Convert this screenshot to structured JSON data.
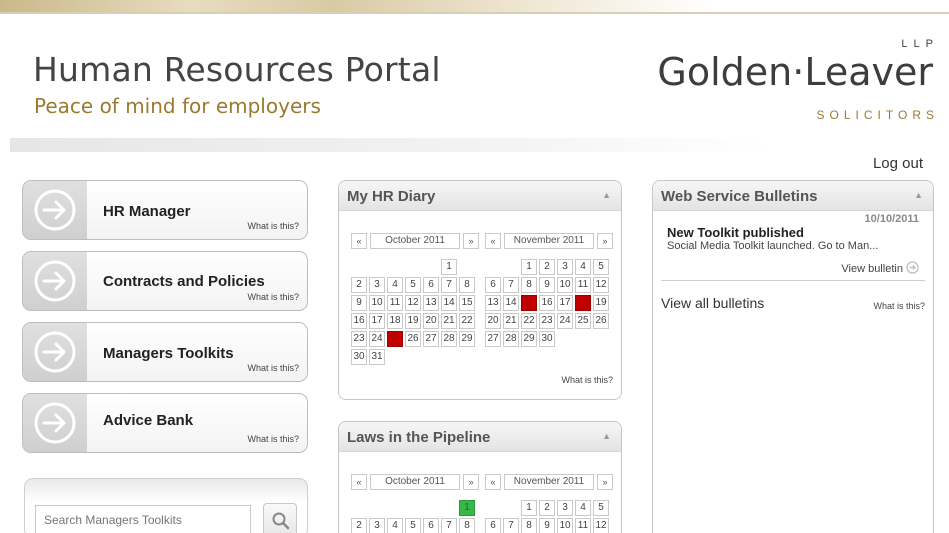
{
  "header": {
    "portal_title": "Human Resources Portal",
    "tagline": "Peace of mind for employers",
    "logo": {
      "llp": "LLP",
      "name": "Golden·Leaver",
      "sub": "SOLICITORS"
    },
    "logout_label": "Log out"
  },
  "nav": {
    "items": [
      {
        "label": "HR Manager",
        "help": "What is this?"
      },
      {
        "label": "Contracts and Policies",
        "help": "What is this?"
      },
      {
        "label": "Managers Toolkits",
        "help": "What is this?"
      },
      {
        "label": "Advice Bank",
        "help": "What is this?"
      }
    ],
    "icon": "arrow-circle-icon"
  },
  "search": {
    "placeholder": "Search Managers Toolkits",
    "icon": "search-icon"
  },
  "diary": {
    "title": "My HR Diary",
    "help": "What is this?",
    "prev": "«",
    "next": "»",
    "october_label": "October 2011",
    "november_label": "November 2011"
  },
  "pipeline": {
    "title": "Laws in the Pipeline",
    "prev": "«",
    "next": "»",
    "october_label": "October 2011",
    "november_label": "November 2011"
  },
  "bulletins": {
    "title": "Web Service Bulletins",
    "date": "10/10/2011",
    "item_title": "New Toolkit published",
    "item_summary": "Social Media Toolkit launched. Go to Man...",
    "view_label": "View bulletin",
    "all_label": "View all bulletins",
    "help": "What is this?"
  },
  "colors": {
    "accent_gold": "#9a7a2e",
    "event_red": "#c00000",
    "event_green": "#39b54a"
  },
  "calendar_rows": {
    "diary_oct": [
      [
        "",
        "",
        "",
        "",
        "",
        "1"
      ],
      [
        "2",
        "3",
        "4",
        "5",
        "6",
        "7",
        "8"
      ],
      [
        "9",
        "10",
        "11",
        "12",
        "13",
        "14",
        "15"
      ],
      [
        "16",
        "17",
        "18",
        "19",
        "20",
        "21",
        "22"
      ],
      [
        "23",
        "24",
        "25",
        "26",
        "27",
        "28",
        "29"
      ],
      [
        "30",
        "31"
      ]
    ],
    "diary_nov": [
      [
        "",
        "",
        "1",
        "2",
        "3",
        "4",
        "5"
      ],
      [
        "6",
        "7",
        "8",
        "9",
        "10",
        "11",
        "12"
      ],
      [
        "13",
        "14",
        "15",
        "16",
        "17",
        "18",
        "19"
      ],
      [
        "20",
        "21",
        "22",
        "23",
        "24",
        "25",
        "26"
      ],
      [
        "27",
        "28",
        "29",
        "30"
      ]
    ],
    "pipe_oct": [
      [
        "",
        "",
        "",
        "",
        "",
        "",
        "1"
      ],
      [
        "2",
        "3",
        "4",
        "5",
        "6",
        "7",
        "8"
      ]
    ],
    "pipe_nov": [
      [
        "",
        "",
        "1",
        "2",
        "3",
        "4",
        "5"
      ],
      [
        "6",
        "7",
        "8",
        "9",
        "10",
        "11",
        "12"
      ]
    ]
  },
  "highlights": {
    "diary_oct_red": [
      "25"
    ],
    "diary_nov_red": [
      "15",
      "18"
    ],
    "pipe_oct_green": [
      "1"
    ]
  }
}
